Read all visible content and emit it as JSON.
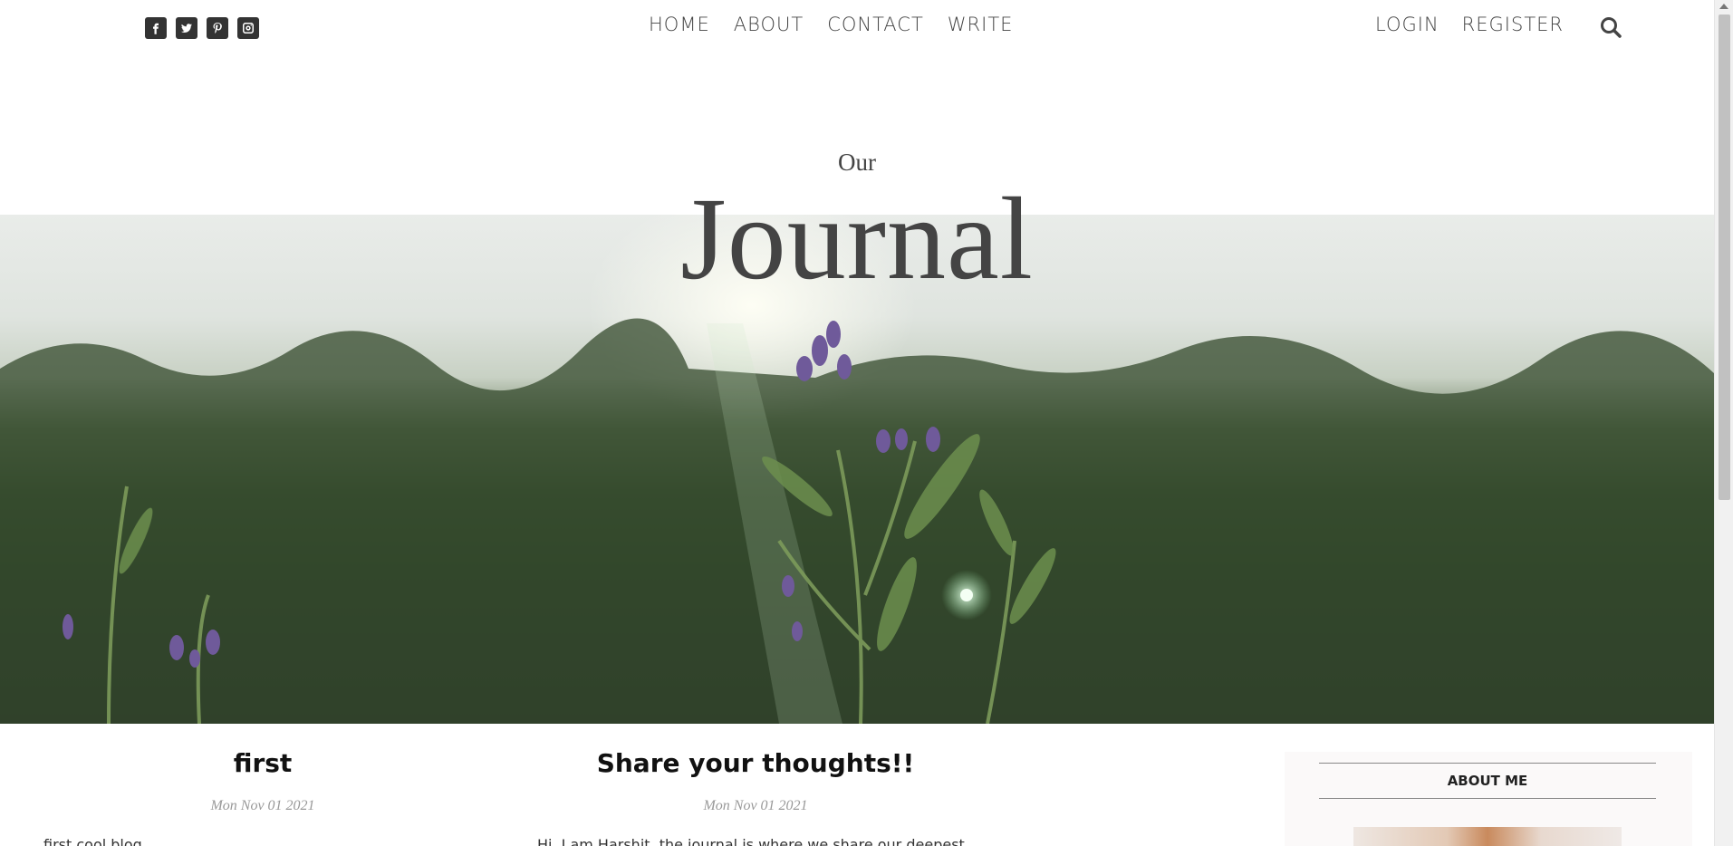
{
  "social": {
    "icons": [
      "facebook-square-icon",
      "twitter-square-icon",
      "pinterest-square-icon",
      "instagram-icon"
    ]
  },
  "nav": {
    "items": [
      "HOME",
      "ABOUT",
      "CONTACT",
      "WRITE"
    ]
  },
  "auth": {
    "login": "LOGIN",
    "register": "REGISTER"
  },
  "hero": {
    "subtitle": "Our",
    "title": "Journal"
  },
  "posts": [
    {
      "title": "first",
      "date": "Mon Nov 01 2021",
      "excerpt": "first cool blog"
    },
    {
      "title": "Share your thoughts!!",
      "date": "Mon Nov 01 2021",
      "excerpt": "Hi, I am Harshit, the journal is where we share our deepest"
    }
  ],
  "sidebar": {
    "title": "ABOUT ME"
  },
  "colors": {
    "text": "#444444",
    "post_title": "#111111",
    "date": "#999999",
    "sidebar_bg": "#fbf9f9"
  }
}
